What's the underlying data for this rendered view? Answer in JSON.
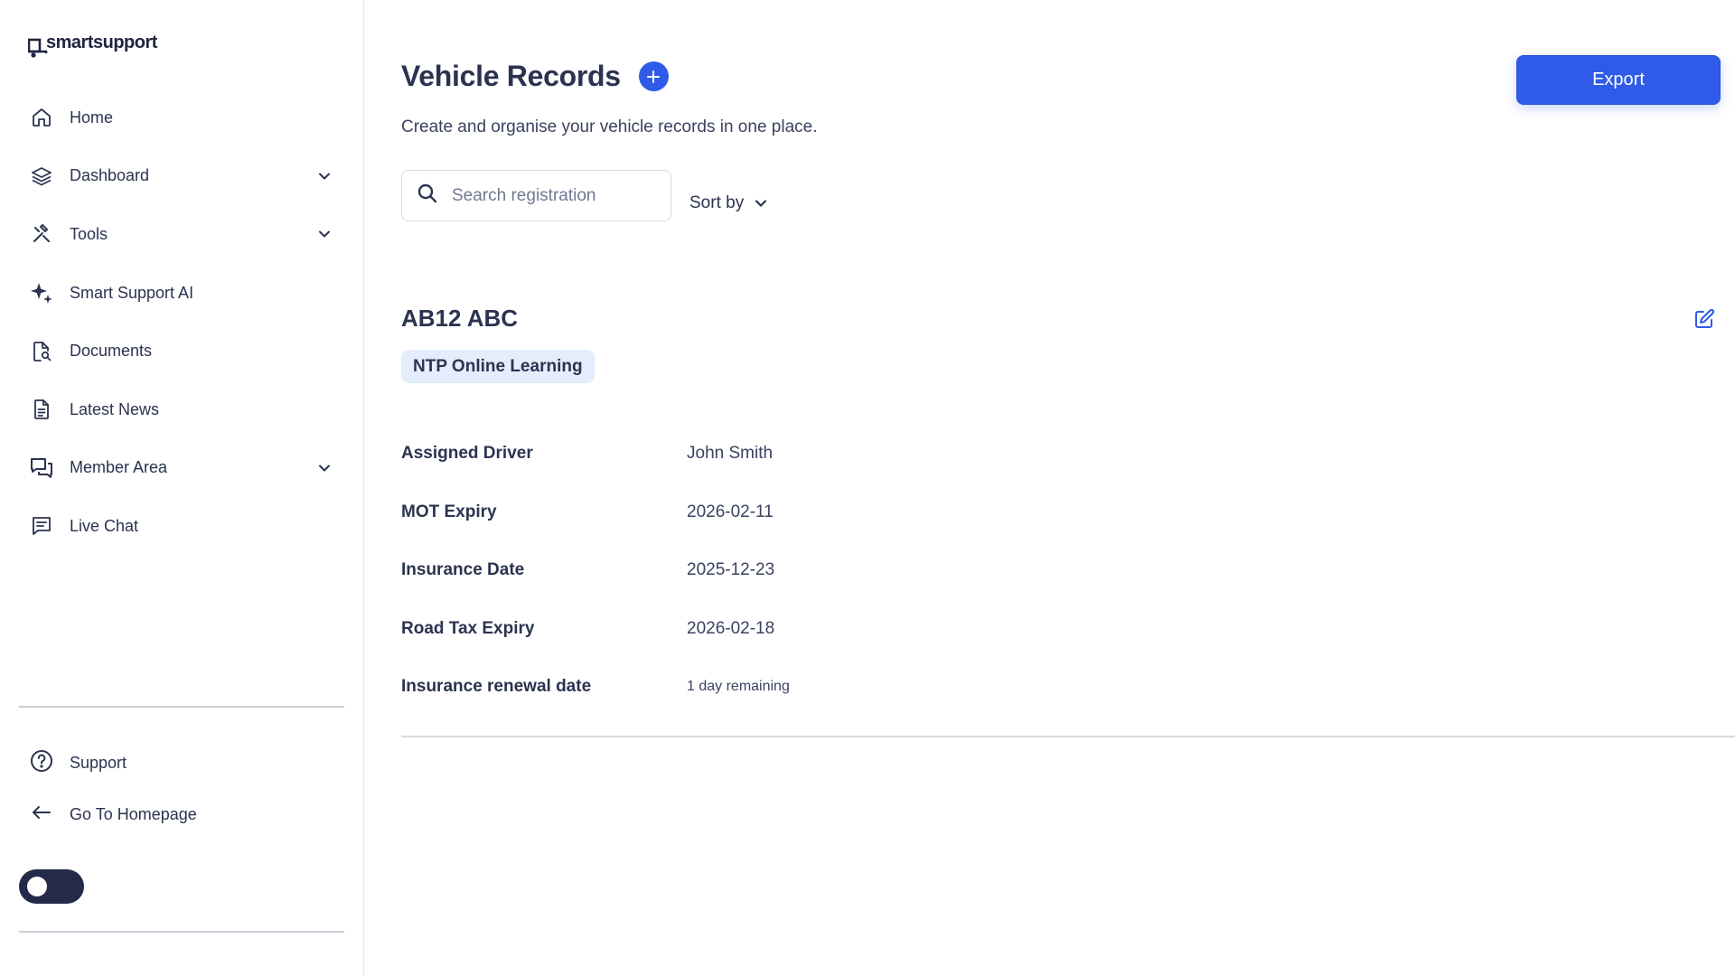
{
  "brand": {
    "name": "smartsupport"
  },
  "sidebar": {
    "items": [
      {
        "label": "Home",
        "icon": "home-icon",
        "has_chevron": false
      },
      {
        "label": "Dashboard",
        "icon": "layers-icon",
        "has_chevron": true
      },
      {
        "label": "Tools",
        "icon": "tools-icon",
        "has_chevron": true
      },
      {
        "label": "Smart Support AI",
        "icon": "sparkles-icon",
        "has_chevron": false
      },
      {
        "label": "Documents",
        "icon": "document-search-icon",
        "has_chevron": false
      },
      {
        "label": "Latest News",
        "icon": "newspaper-icon",
        "has_chevron": false
      },
      {
        "label": "Member Area",
        "icon": "chat-bubbles-icon",
        "has_chevron": true
      },
      {
        "label": "Live Chat",
        "icon": "chat-icon",
        "has_chevron": false
      }
    ],
    "bottom": {
      "support_label": "Support",
      "homepage_label": "Go To Homepage"
    },
    "theme_toggle": {
      "state": "off"
    }
  },
  "main": {
    "title": "Vehicle Records",
    "subtitle": "Create and organise your vehicle records in one place.",
    "export_label": "Export",
    "search": {
      "placeholder": "Search registration",
      "value": ""
    },
    "sort_label": "Sort by",
    "record": {
      "registration": "AB12 ABC",
      "tag": "NTP Online Learning",
      "fields": [
        {
          "label": "Assigned Driver",
          "value": "John Smith"
        },
        {
          "label": "MOT Expiry",
          "value": "2026-02-11"
        },
        {
          "label": "Insurance Date",
          "value": "2025-12-23"
        },
        {
          "label": "Road Tax Expiry",
          "value": "2026-02-18"
        },
        {
          "label": "Insurance renewal date",
          "value": "1 day remaining"
        }
      ]
    }
  },
  "colors": {
    "accent": "#2f5be8",
    "text": "#2b3350",
    "tag_bg": "#e4edfb",
    "toggle_bg": "#232a4a"
  }
}
